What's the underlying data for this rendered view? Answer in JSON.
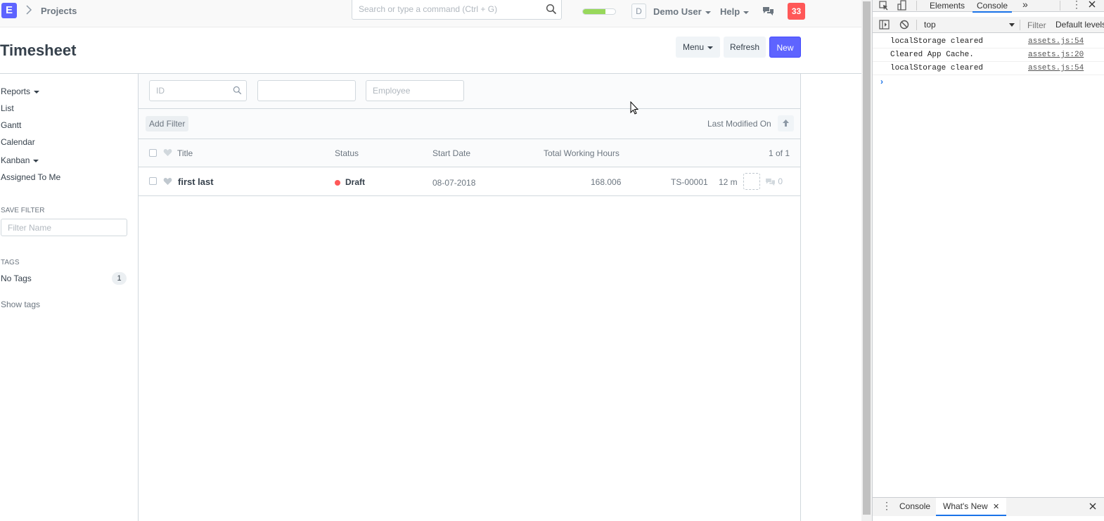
{
  "navbar": {
    "logo_letter": "E",
    "breadcrumb": "Projects",
    "search_placeholder": "Search or type a command (Ctrl + G)",
    "progress_fraction": 0.7,
    "user_initial": "D",
    "user_name": "Demo User",
    "help_label": "Help",
    "notification_count": "33"
  },
  "page": {
    "title": "Timesheet",
    "menu_label": "Menu",
    "refresh_label": "Refresh",
    "new_label": "New"
  },
  "sidebar": {
    "reports_label": "Reports",
    "list_label": "List",
    "gantt_label": "Gantt",
    "calendar_label": "Calendar",
    "kanban_label": "Kanban",
    "assigned_label": "Assigned To Me",
    "save_filter_label": "SAVE FILTER",
    "filter_name_placeholder": "Filter Name",
    "tags_label": "TAGS",
    "no_tags_label": "No Tags",
    "no_tags_count": "1",
    "show_tags_label": "Show tags"
  },
  "filters": {
    "id_placeholder": "ID",
    "second_placeholder": "",
    "employee_placeholder": "Employee",
    "add_filter_label": "Add Filter",
    "sort_label": "Last Modified On"
  },
  "list": {
    "columns": {
      "title": "Title",
      "status": "Status",
      "start_date": "Start Date",
      "total_hours": "Total Working Hours",
      "count": "1 of 1"
    },
    "rows": [
      {
        "title": "first last",
        "status": "Draft",
        "start_date": "08-07-2018",
        "total_hours": "168.006",
        "name": "TS-00001",
        "modified": "12 m",
        "comments": "0"
      }
    ]
  },
  "devtools": {
    "elements_tab": "Elements",
    "console_tab": "Console",
    "context": "top",
    "filter_placeholder": "Filter",
    "levels_label": "Default levels",
    "messages": [
      {
        "text": "localStorage cleared",
        "source": "assets.js:54"
      },
      {
        "text": "Cleared App Cache.",
        "source": "assets.js:20"
      },
      {
        "text": "localStorage cleared",
        "source": "assets.js:54"
      }
    ],
    "drawer_console_tab": "Console",
    "drawer_whatsnew_tab": "What's New"
  },
  "colors": {
    "primary": "#5e64ff",
    "danger": "#ff5858",
    "progress": "#98d85b",
    "devtools_accent": "#1a73e8"
  }
}
